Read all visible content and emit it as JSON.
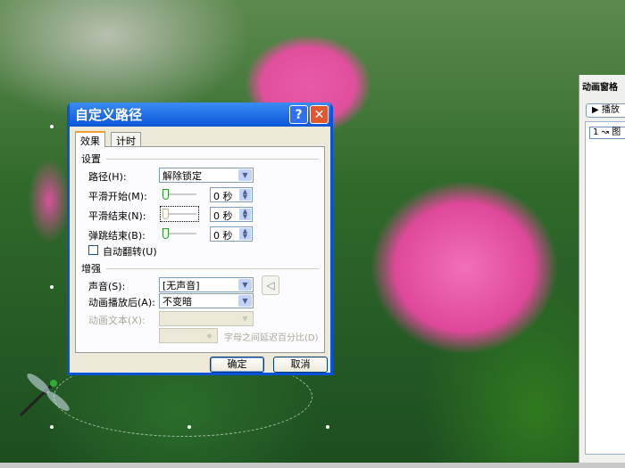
{
  "dialog": {
    "title": "自定义路径",
    "help_label": "?",
    "close_label": "✕",
    "tabs": [
      "效果",
      "计时"
    ],
    "settings_group": "设置",
    "path_label": "路径(H):",
    "path_value": "解除锁定",
    "smooth_start_label": "平滑开始(M):",
    "smooth_start_value": "0 秒",
    "smooth_end_label": "平滑结束(N):",
    "smooth_end_value": "0 秒",
    "bounce_end_label": "弹跳结束(B):",
    "bounce_end_value": "0 秒",
    "auto_reverse_label": "自动翻转(U)",
    "auto_reverse_checked": false,
    "enhance_group": "增强",
    "sound_label": "声音(S):",
    "sound_value": "[无声音]",
    "after_anim_label": "动画播放后(A):",
    "after_anim_value": "不变暗",
    "anim_text_label": "动画文本(X):",
    "anim_text_value": "",
    "letter_delay_label": "字母之间延迟百分比(D)",
    "ok_label": "确定",
    "cancel_label": "取消"
  },
  "animation_pane": {
    "title": "动画窗格",
    "play_label": "▶ 播放",
    "items": [
      {
        "text": "1 ↝ 图"
      }
    ]
  }
}
